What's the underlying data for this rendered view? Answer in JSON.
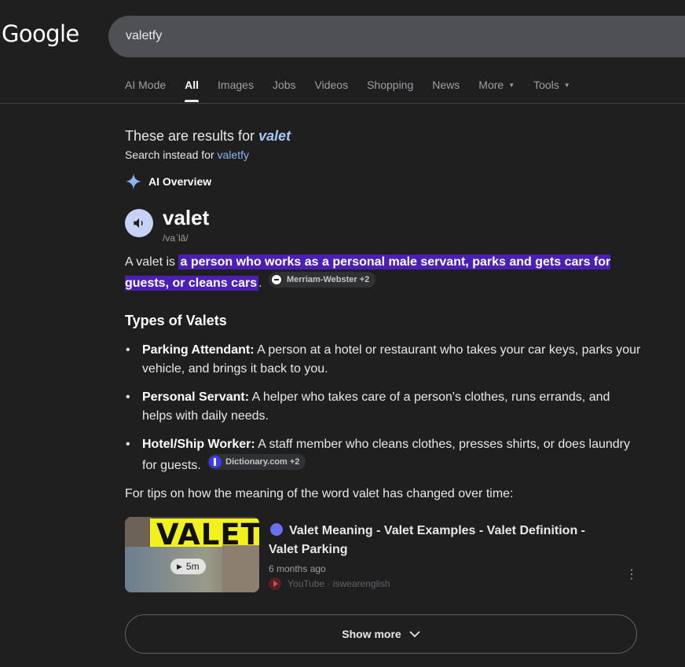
{
  "header": {
    "logo": "Google",
    "search_value": "valetfy"
  },
  "tabs": [
    {
      "label": "AI Mode"
    },
    {
      "label": "All"
    },
    {
      "label": "Images"
    },
    {
      "label": "Jobs"
    },
    {
      "label": "Videos"
    },
    {
      "label": "Shopping"
    },
    {
      "label": "News"
    },
    {
      "label": "More"
    },
    {
      "label": "Tools"
    }
  ],
  "correction": {
    "prefix": "These are results for ",
    "query": "valet",
    "instead_prefix": "Search instead for ",
    "instead_query": "valetfy"
  },
  "ai_overview": {
    "label": "AI Overview",
    "word": "valet",
    "pronunciation": "/vaˈlā/",
    "definition_prefix": "A valet is ",
    "definition_highlight": "a person who works as a personal male servant, parks and gets cars for guests, or cleans cars",
    "definition_suffix": ".",
    "definition_source": "Merriam-Webster +2",
    "types_heading": "Types of Valets",
    "types": [
      {
        "term": "Parking Attendant:",
        "text": " A person at a hotel or restaurant who takes your car keys, parks your vehicle, and brings it back to you."
      },
      {
        "term": "Personal Servant:",
        "text": " A helper who takes care of a person's clothes, runs errands, and helps with daily needs."
      },
      {
        "term": "Hotel/Ship Worker:",
        "text": " A staff member who cleans clothes, presses shirts, or does laundry for guests."
      }
    ],
    "types_source": "Dictionary.com +2",
    "tips": "For tips on how the meaning of the word valet has changed over time:",
    "video": {
      "thumb_word": "VALET",
      "duration": "5m",
      "title": "Valet Meaning - Valet Examples - Valet Definition - Valet Parking",
      "age": "6 months ago",
      "source": "YouTube · iswearenglish"
    },
    "show_more": "Show more"
  },
  "colors": {
    "background": "#1f1f1f",
    "highlight": "#4c1fb4",
    "link": "#8ab4f8",
    "speaker": "#c7d3f6"
  }
}
